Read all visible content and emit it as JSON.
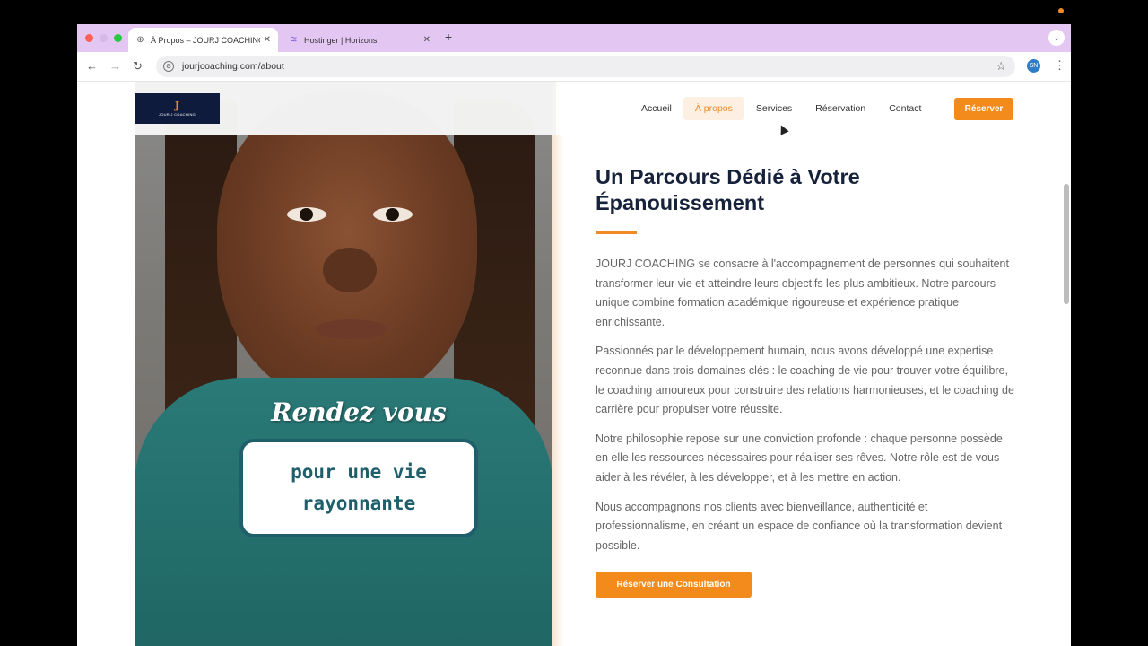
{
  "browser": {
    "tabs": [
      {
        "title": "À Propos – JOURJ COACHING",
        "active": true
      },
      {
        "title": "Hostinger | Horizons",
        "active": false
      }
    ],
    "new_tab_label": "+",
    "url": "jourjcoaching.com/about",
    "profile_initials": "SN"
  },
  "site": {
    "logo_mark": "J",
    "logo_name": "JOUR J COACHING",
    "nav": [
      "Accueil",
      "À propos",
      "Services",
      "Réservation",
      "Contact"
    ],
    "nav_active": "À propos",
    "reserve_button": "Réserver"
  },
  "hero_image": {
    "overlay_title": "Rendez vous",
    "overlay_card_text": "pour une vie rayonnante"
  },
  "content": {
    "title": "Un Parcours Dédié à Votre Épanouissement",
    "paragraphs": [
      "JOURJ COACHING se consacre à l'accompagnement de personnes qui souhaitent transformer leur vie et atteindre leurs objectifs les plus ambitieux. Notre parcours unique combine formation académique rigoureuse et expérience pratique enrichissante.",
      "Passionnés par le développement humain, nous avons développé une expertise reconnue dans trois domaines clés : le coaching de vie pour trouver votre équilibre, le coaching amoureux pour construire des relations harmonieuses, et le coaching de carrière pour propulser votre réussite.",
      "Notre philosophie repose sur une conviction profonde : chaque personne possède en elle les ressources nécessaires pour réaliser ses rêves. Notre rôle est de vous aider à les révéler, à les développer, et à les mettre en action.",
      "Nous accompagnons nos clients avec bienveillance, authenticité et professionnalisme, en créant un espace de confiance où la transformation devient possible."
    ],
    "cta_button": "Réserver une Consultation"
  },
  "colors": {
    "accent": "#f28a1c",
    "navy": "#16213a",
    "tab_strip": "#e3c6f2"
  }
}
